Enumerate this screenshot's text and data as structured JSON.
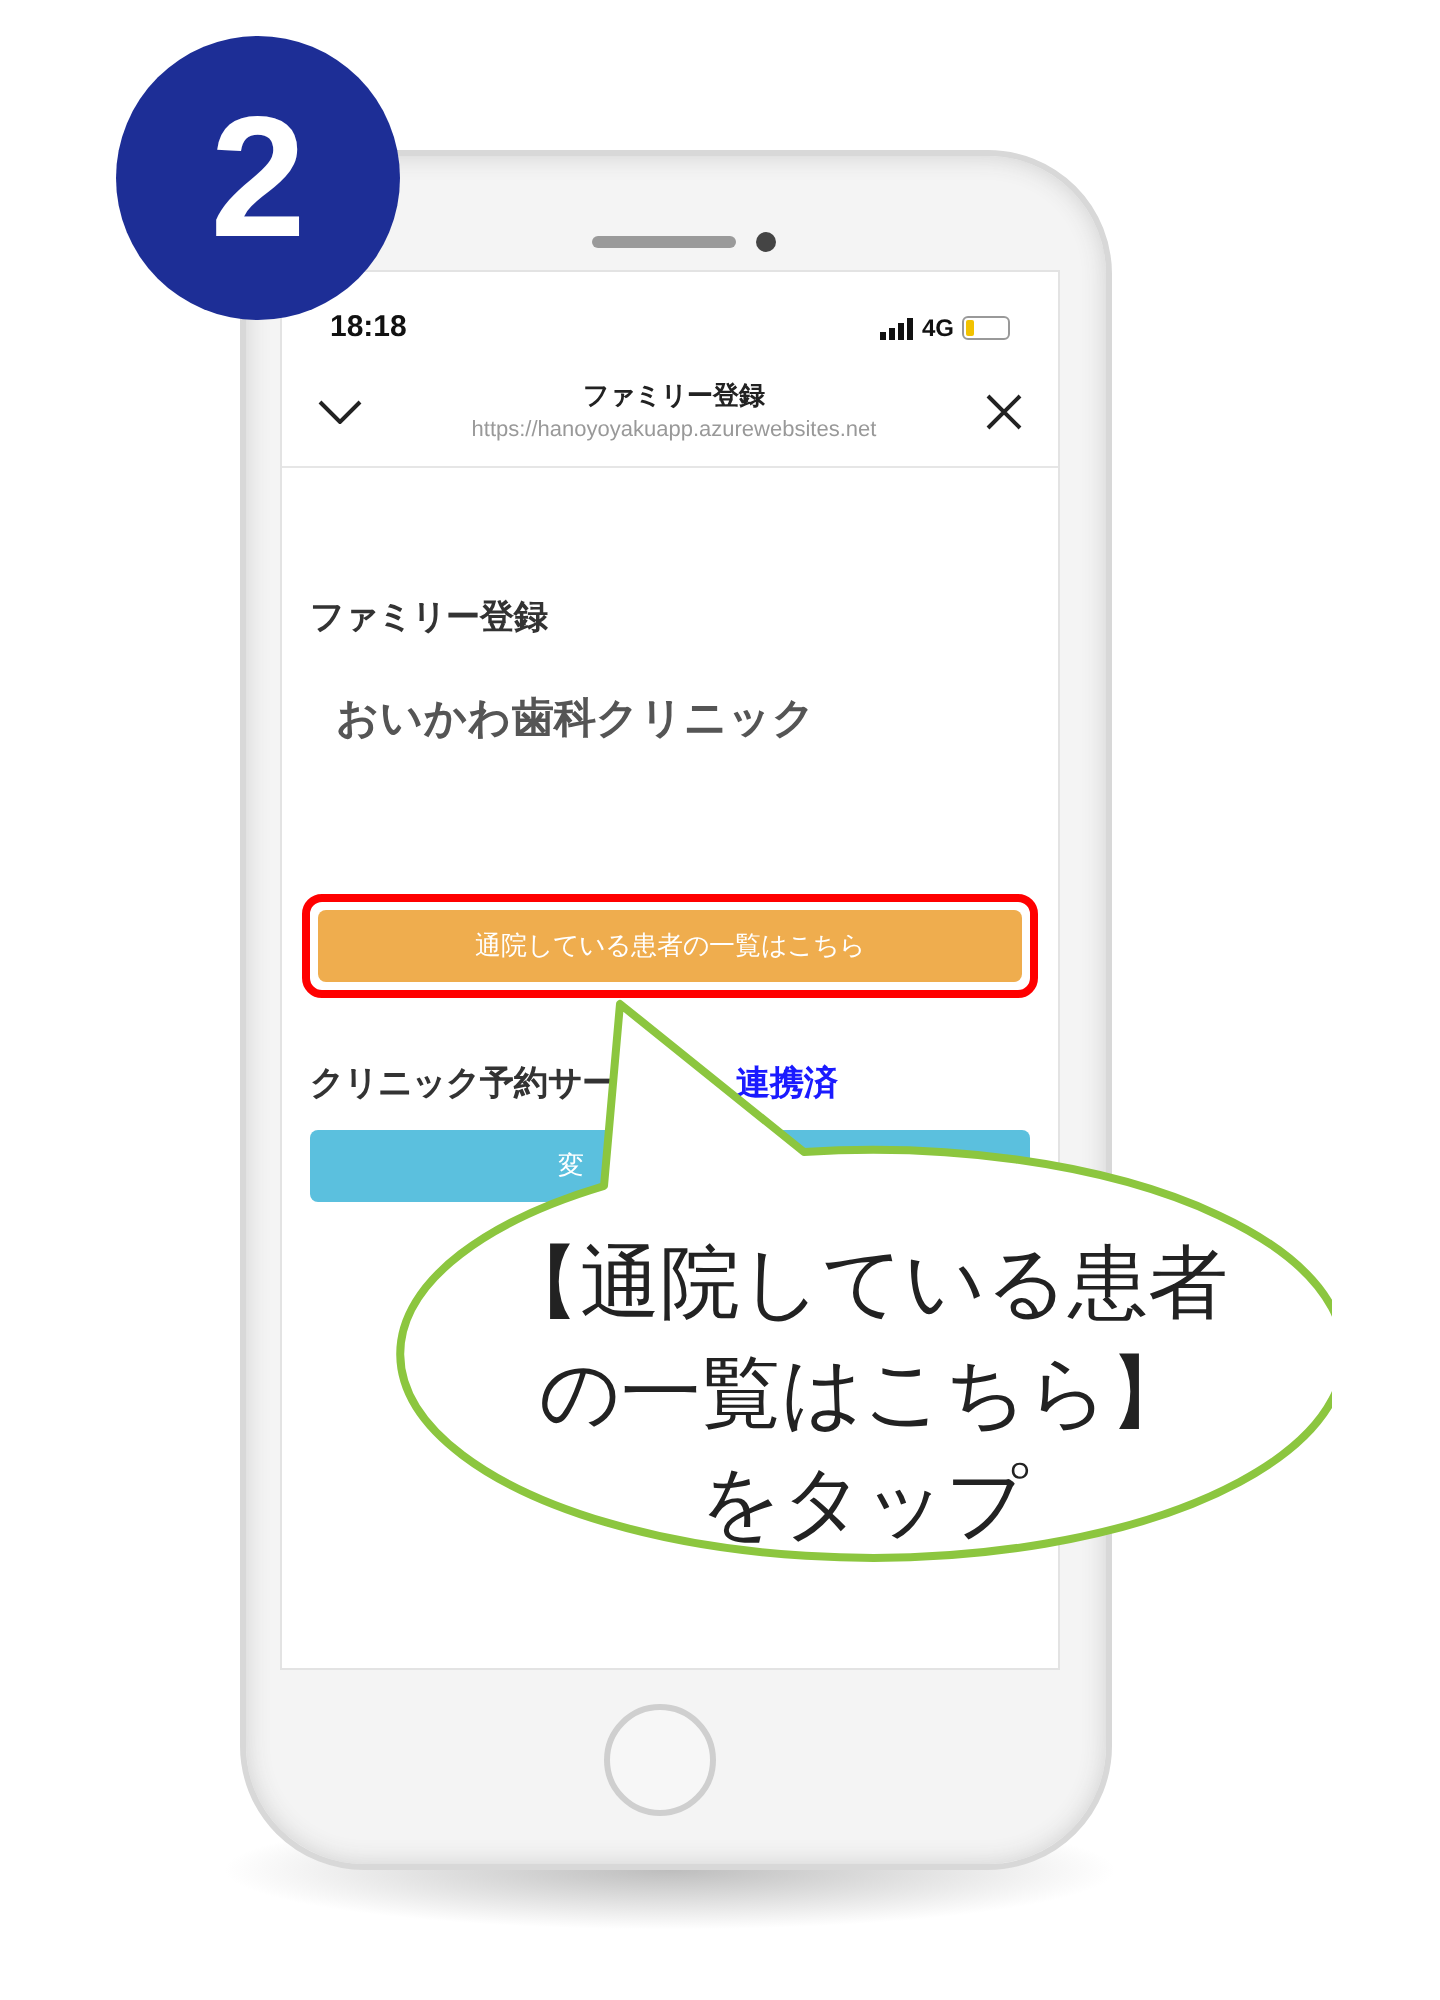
{
  "step_badge": {
    "number": "2"
  },
  "status_bar": {
    "time": "18:18",
    "network": "4G"
  },
  "header": {
    "title": "ファミリー登録",
    "url": "https://hanoyoyakuapp.azurewebsites.net"
  },
  "page": {
    "heading": "ファミリー登録",
    "clinic_name": "おいかわ歯科クリニック",
    "patients_button": "通院している患者の一覧はこちら",
    "patients_button_highlighted": true,
    "service_label": "クリニック予約サー",
    "service_status": "連携済",
    "change_button": "変"
  },
  "callout": {
    "lines": [
      "【通院している患者",
      "の一覧はこちら】",
      "をタップ"
    ]
  }
}
